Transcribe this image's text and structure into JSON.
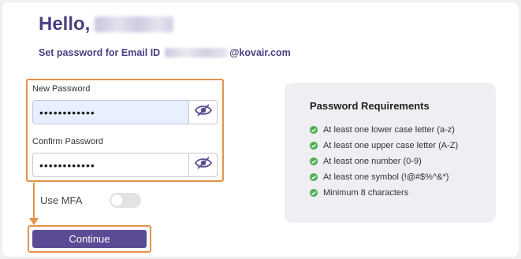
{
  "greeting": {
    "prefix": "Hello,"
  },
  "subtitle": {
    "prefix": "Set password for Email ID",
    "domain": "@kovair.com"
  },
  "fields": {
    "new_password": {
      "label": "New Password",
      "value": "••••••••••••",
      "toggle_icon": "eye-slash-icon"
    },
    "confirm_password": {
      "label": "Confirm Password",
      "value": "••••••••••••",
      "toggle_icon": "eye-slash-icon"
    }
  },
  "mfa": {
    "label": "Use MFA",
    "enabled": false
  },
  "continue_button": {
    "label": "Continue"
  },
  "requirements": {
    "title": "Password Requirements",
    "items": [
      "At least one lower case letter (a-z)",
      "At least one upper case letter (A-Z)",
      "At least one number (0-9)",
      "At least one symbol (!@#$%^&*)",
      "Minimum 8 characters"
    ],
    "check_icon": "check-circle-icon"
  },
  "colors": {
    "brand": "#5b4b94",
    "heading": "#4a3f82",
    "highlight": "#e5924a",
    "check": "#4caf50",
    "panel_bg": "#eeeef3"
  }
}
